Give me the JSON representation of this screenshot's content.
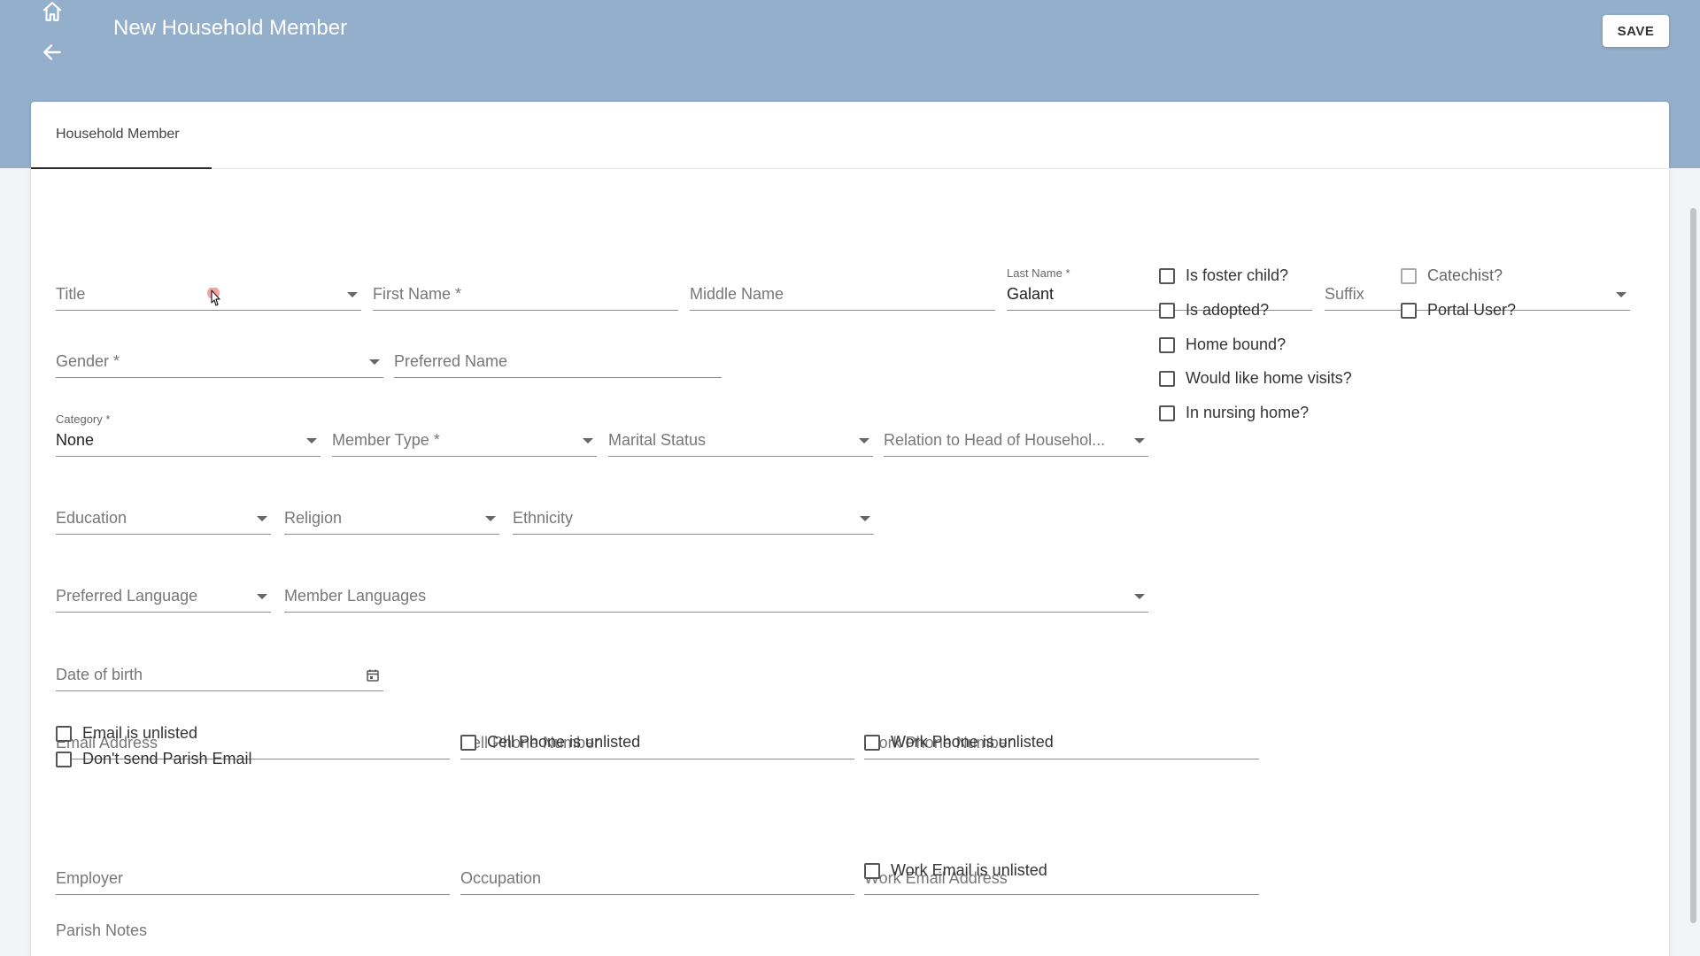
{
  "header": {
    "title": "New Household Member",
    "save_label": "SAVE"
  },
  "tabs": [
    {
      "label": "Household Member"
    }
  ],
  "fields": {
    "title": "Title",
    "first_name": "First Name *",
    "middle_name": "Middle Name",
    "last_name_label": "Last Name *",
    "last_name_value": "Galant",
    "suffix": "Suffix",
    "gender": "Gender *",
    "preferred_name": "Preferred Name",
    "category_label": "Category *",
    "category_value": "None",
    "member_type": "Member Type *",
    "marital_status": "Marital Status",
    "relation": "Relation to Head of Househol...",
    "education": "Education",
    "religion": "Religion",
    "ethnicity": "Ethnicity",
    "preferred_language": "Preferred Language",
    "member_languages": "Member Languages",
    "date_of_birth": "Date of birth",
    "email_address": "Email Address",
    "cell_phone": "Cell Phone Number",
    "work_phone": "Work Phone Number",
    "employer": "Employer",
    "occupation": "Occupation",
    "work_email": "Work Email Address",
    "parish_notes": "Parish Notes"
  },
  "checkboxes": {
    "foster_child": "Is foster child?",
    "catechist": "Catechist?",
    "adopted": "Is adopted?",
    "portal_user": "Portal User?",
    "home_bound": "Home bound?",
    "home_visits": "Would like home visits?",
    "nursing_home": "In nursing home?",
    "email_unlisted": "Email is unlisted",
    "no_parish_email": "Don't send Parish Email",
    "cell_unlisted": "Cell Phone is unlisted",
    "work_phone_unlisted": "Work Phone is unlisted",
    "work_email_unlisted": "Work Email is unlisted"
  },
  "colors": {
    "header_bg": "#94afcb",
    "card_bg": "#ffffff"
  }
}
